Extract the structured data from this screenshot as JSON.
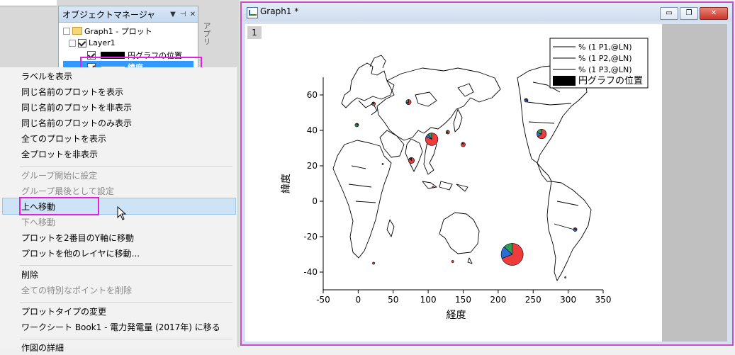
{
  "object_manager": {
    "title": "オブジェクトマネージャ",
    "pin_label": "▼ ⊣",
    "close_label": "✕",
    "side_tab": "アプリ",
    "tree": {
      "graph": "Graph1 - プロット",
      "layer": "Layer1",
      "pie_position": "円グラフの位置",
      "latitude": "緯度"
    }
  },
  "context_menu": {
    "items": [
      {
        "label": "ラベルを表示",
        "enabled": true
      },
      {
        "label": "同じ名前のプロットを表示",
        "enabled": true
      },
      {
        "label": "同じ名前のプロットを非表示",
        "enabled": true
      },
      {
        "label": "同じ名前のプロットのみ表示",
        "enabled": true
      },
      {
        "label": "全てのプロットを表示",
        "enabled": true
      },
      {
        "label": "全プロットを非表示",
        "enabled": true
      },
      {
        "label": "グループ開始に設定",
        "enabled": false
      },
      {
        "label": "グループ最後として設定",
        "enabled": false
      },
      {
        "label": "上へ移動",
        "enabled": true
      },
      {
        "label": "下へ移動",
        "enabled": false
      },
      {
        "label": "プロットを2番目のY軸に移動",
        "enabled": true
      },
      {
        "label": "プロットを他のレイヤに移動...",
        "enabled": true
      },
      {
        "label": "削除",
        "enabled": true
      },
      {
        "label": "全ての特別なポイントを削除",
        "enabled": false
      },
      {
        "label": "プロットタイプの変更",
        "enabled": true
      },
      {
        "label": "ワークシート Book1 - 電力発電量 (2017年) に移る",
        "enabled": true
      },
      {
        "label": "作図の詳細",
        "enabled": true
      }
    ],
    "hovered": "上へ移動"
  },
  "graph_window": {
    "title": "Graph1 *",
    "minimize": "▭",
    "restore": "❐",
    "close": "✕",
    "layer_number": "1"
  },
  "colors": {
    "series1": "#ee3b3b",
    "series2": "#2b6fd6",
    "series3": "#2e9e55",
    "accent_highlight": "#e022e0"
  },
  "chart_data": {
    "type": "scatter",
    "xlabel": "経度",
    "ylabel": "緯度",
    "xlim": [
      -50,
      350
    ],
    "ylim": [
      -50,
      70
    ],
    "xticks": [
      -50,
      0,
      50,
      100,
      150,
      200,
      250,
      300,
      350
    ],
    "yticks": [
      -40,
      -20,
      0,
      20,
      40,
      60
    ],
    "legend": {
      "placement": "top-right",
      "entries": [
        "% (1 P1,@LN)",
        "% (1 P2,@LN)",
        "% (1 P3,@LN)",
        "円グラフの位置"
      ]
    },
    "pies": [
      {
        "lon": 22,
        "lat": 55,
        "r": 2.5,
        "p": [
          75,
          15,
          10
        ]
      },
      {
        "lon": 72,
        "lat": 56,
        "r": 3.5,
        "p": [
          55,
          15,
          30
        ]
      },
      {
        "lon": -2,
        "lat": 43,
        "r": 2.5,
        "p": [
          15,
          10,
          75
        ]
      },
      {
        "lon": 128,
        "lat": 39,
        "r": 2.5,
        "p": [
          60,
          10,
          30
        ]
      },
      {
        "lon": 105,
        "lat": 35,
        "r": 8.5,
        "p": [
          82,
          8,
          10
        ]
      },
      {
        "lon": 150,
        "lat": 32,
        "r": 3,
        "p": [
          90,
          5,
          5
        ]
      },
      {
        "lon": 76,
        "lat": 23,
        "r": 4,
        "p": [
          88,
          7,
          5
        ]
      },
      {
        "lon": 35,
        "lat": 21,
        "r": 1,
        "p": [
          100,
          0,
          0
        ]
      },
      {
        "lon": 107,
        "lat": 8,
        "r": 1.2,
        "p": [
          100,
          0,
          0
        ]
      },
      {
        "lon": 240,
        "lat": 57,
        "r": 2.5,
        "p": [
          25,
          60,
          15
        ]
      },
      {
        "lon": 262,
        "lat": 38,
        "r": 6.5,
        "p": [
          65,
          15,
          20
        ]
      },
      {
        "lon": 310,
        "lat": -16,
        "r": 2.5,
        "p": [
          20,
          70,
          10
        ]
      },
      {
        "lon": 220,
        "lat": -30,
        "r": 15,
        "p": [
          69,
          18,
          13
        ]
      },
      {
        "lon": 135,
        "lat": -34,
        "r": 1.5,
        "p": [
          100,
          0,
          0
        ]
      },
      {
        "lon": 22,
        "lat": -35,
        "r": 1.5,
        "p": [
          100,
          0,
          0
        ]
      },
      {
        "lon": 296,
        "lat": -43,
        "r": 1,
        "p": [
          100,
          0,
          0
        ]
      }
    ]
  }
}
